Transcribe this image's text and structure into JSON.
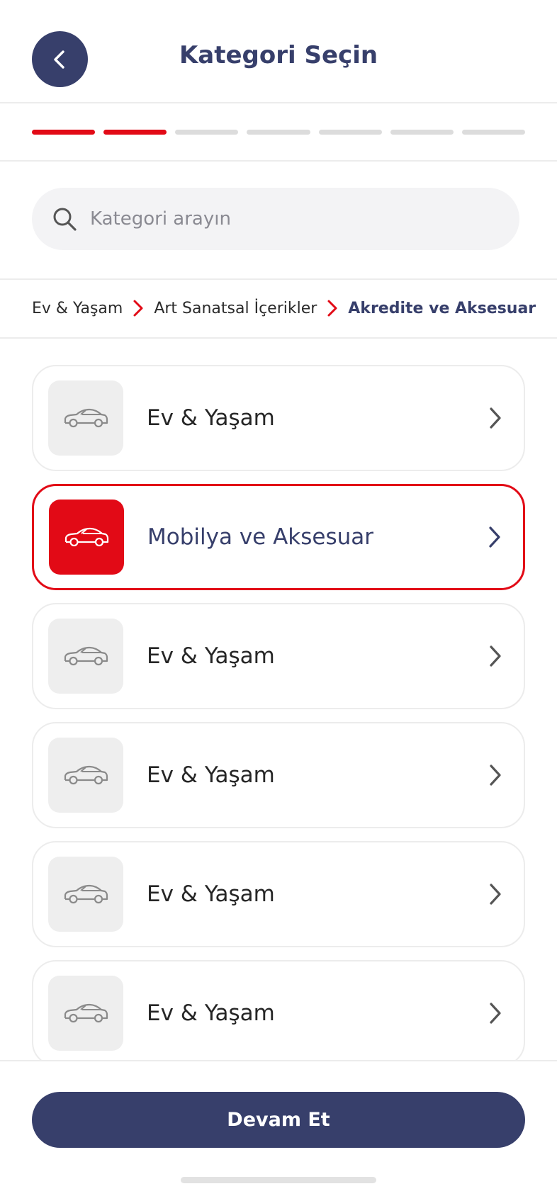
{
  "header": {
    "title": "Kategori Seçin"
  },
  "progress": {
    "total_steps": 7,
    "current_step": 2
  },
  "search": {
    "placeholder": "Kategori arayın"
  },
  "breadcrumb": [
    {
      "label": "Ev & Yaşam"
    },
    {
      "label": "Art Sanatsal İçerikler"
    },
    {
      "label": "Akredite ve Aksesuar"
    }
  ],
  "categories": [
    {
      "label": "Ev & Yaşam",
      "icon": "car-icon",
      "selected": false
    },
    {
      "label": "Mobilya ve Aksesuar",
      "icon": "car-icon",
      "selected": true
    },
    {
      "label": "Ev & Yaşam",
      "icon": "car-icon",
      "selected": false
    },
    {
      "label": "Ev & Yaşam",
      "icon": "car-icon",
      "selected": false
    },
    {
      "label": "Ev & Yaşam",
      "icon": "car-icon",
      "selected": false
    },
    {
      "label": "Ev & Yaşam",
      "icon": "car-icon",
      "selected": false
    }
  ],
  "footer": {
    "continue_label": "Devam Et"
  },
  "colors": {
    "brand_navy": "#373f6b",
    "accent_red": "#e20a16",
    "inactive_gray": "#dcdcdc"
  }
}
